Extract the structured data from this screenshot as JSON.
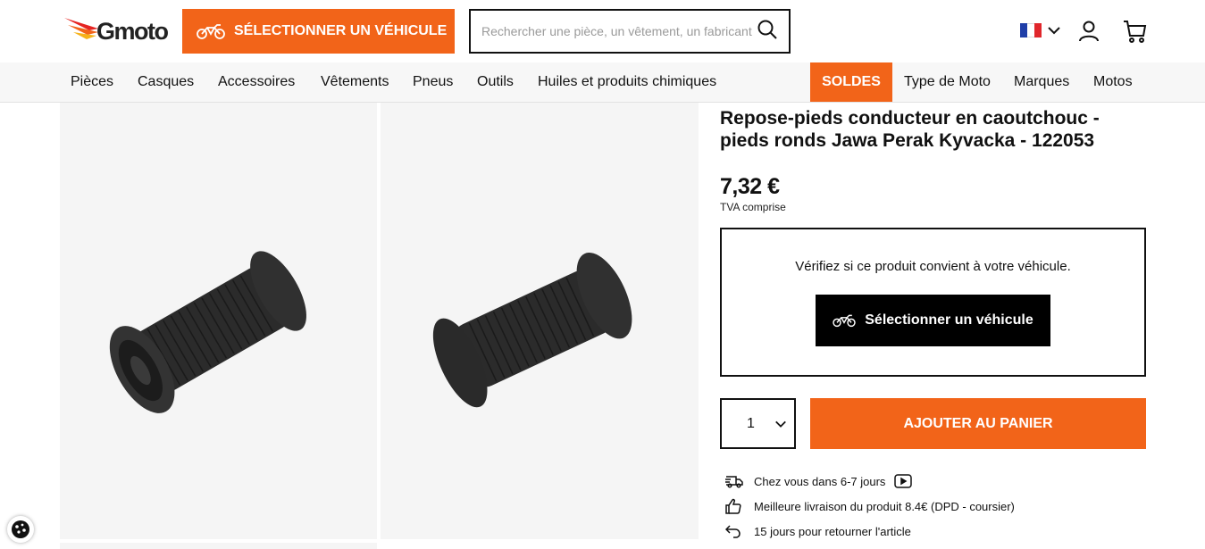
{
  "header": {
    "logo_text": "Gmoto",
    "select_vehicle_label": "SÉLECTIONNER UN VÉHICULE",
    "search_placeholder": "Rechercher une pièce, un vêtement, un fabricant",
    "language": "FR"
  },
  "nav": {
    "items": [
      "Pièces",
      "Casques",
      "Accessoires",
      "Vêtements",
      "Pneus",
      "Outils",
      "Huiles et produits chimiques"
    ],
    "soldes": "SOLDES",
    "right_items": [
      "Type de Moto",
      "Marques",
      "Motos"
    ]
  },
  "product": {
    "title": "Repose-pieds conducteur en caoutchouc - pieds ronds Jawa Perak Kyvacka - 122053",
    "price": "7,32 €",
    "vat": "TVA comprise",
    "check_text": "Vérifiez si ce produit convient à votre véhicule.",
    "check_button": "Sélectionner un véhicule",
    "quantity": "1",
    "add_to_cart": "AJOUTER AU PANIER"
  },
  "info": {
    "delivery": "Chez vous dans 6-7 jours",
    "best_delivery": "Meilleure livraison du produit 8.4€ (DPD - coursier)",
    "returns": "15 jours pour retourner l'article"
  },
  "colors": {
    "accent": "#f26419",
    "dark": "#111111",
    "tile_bg": "#f5f5f5"
  }
}
